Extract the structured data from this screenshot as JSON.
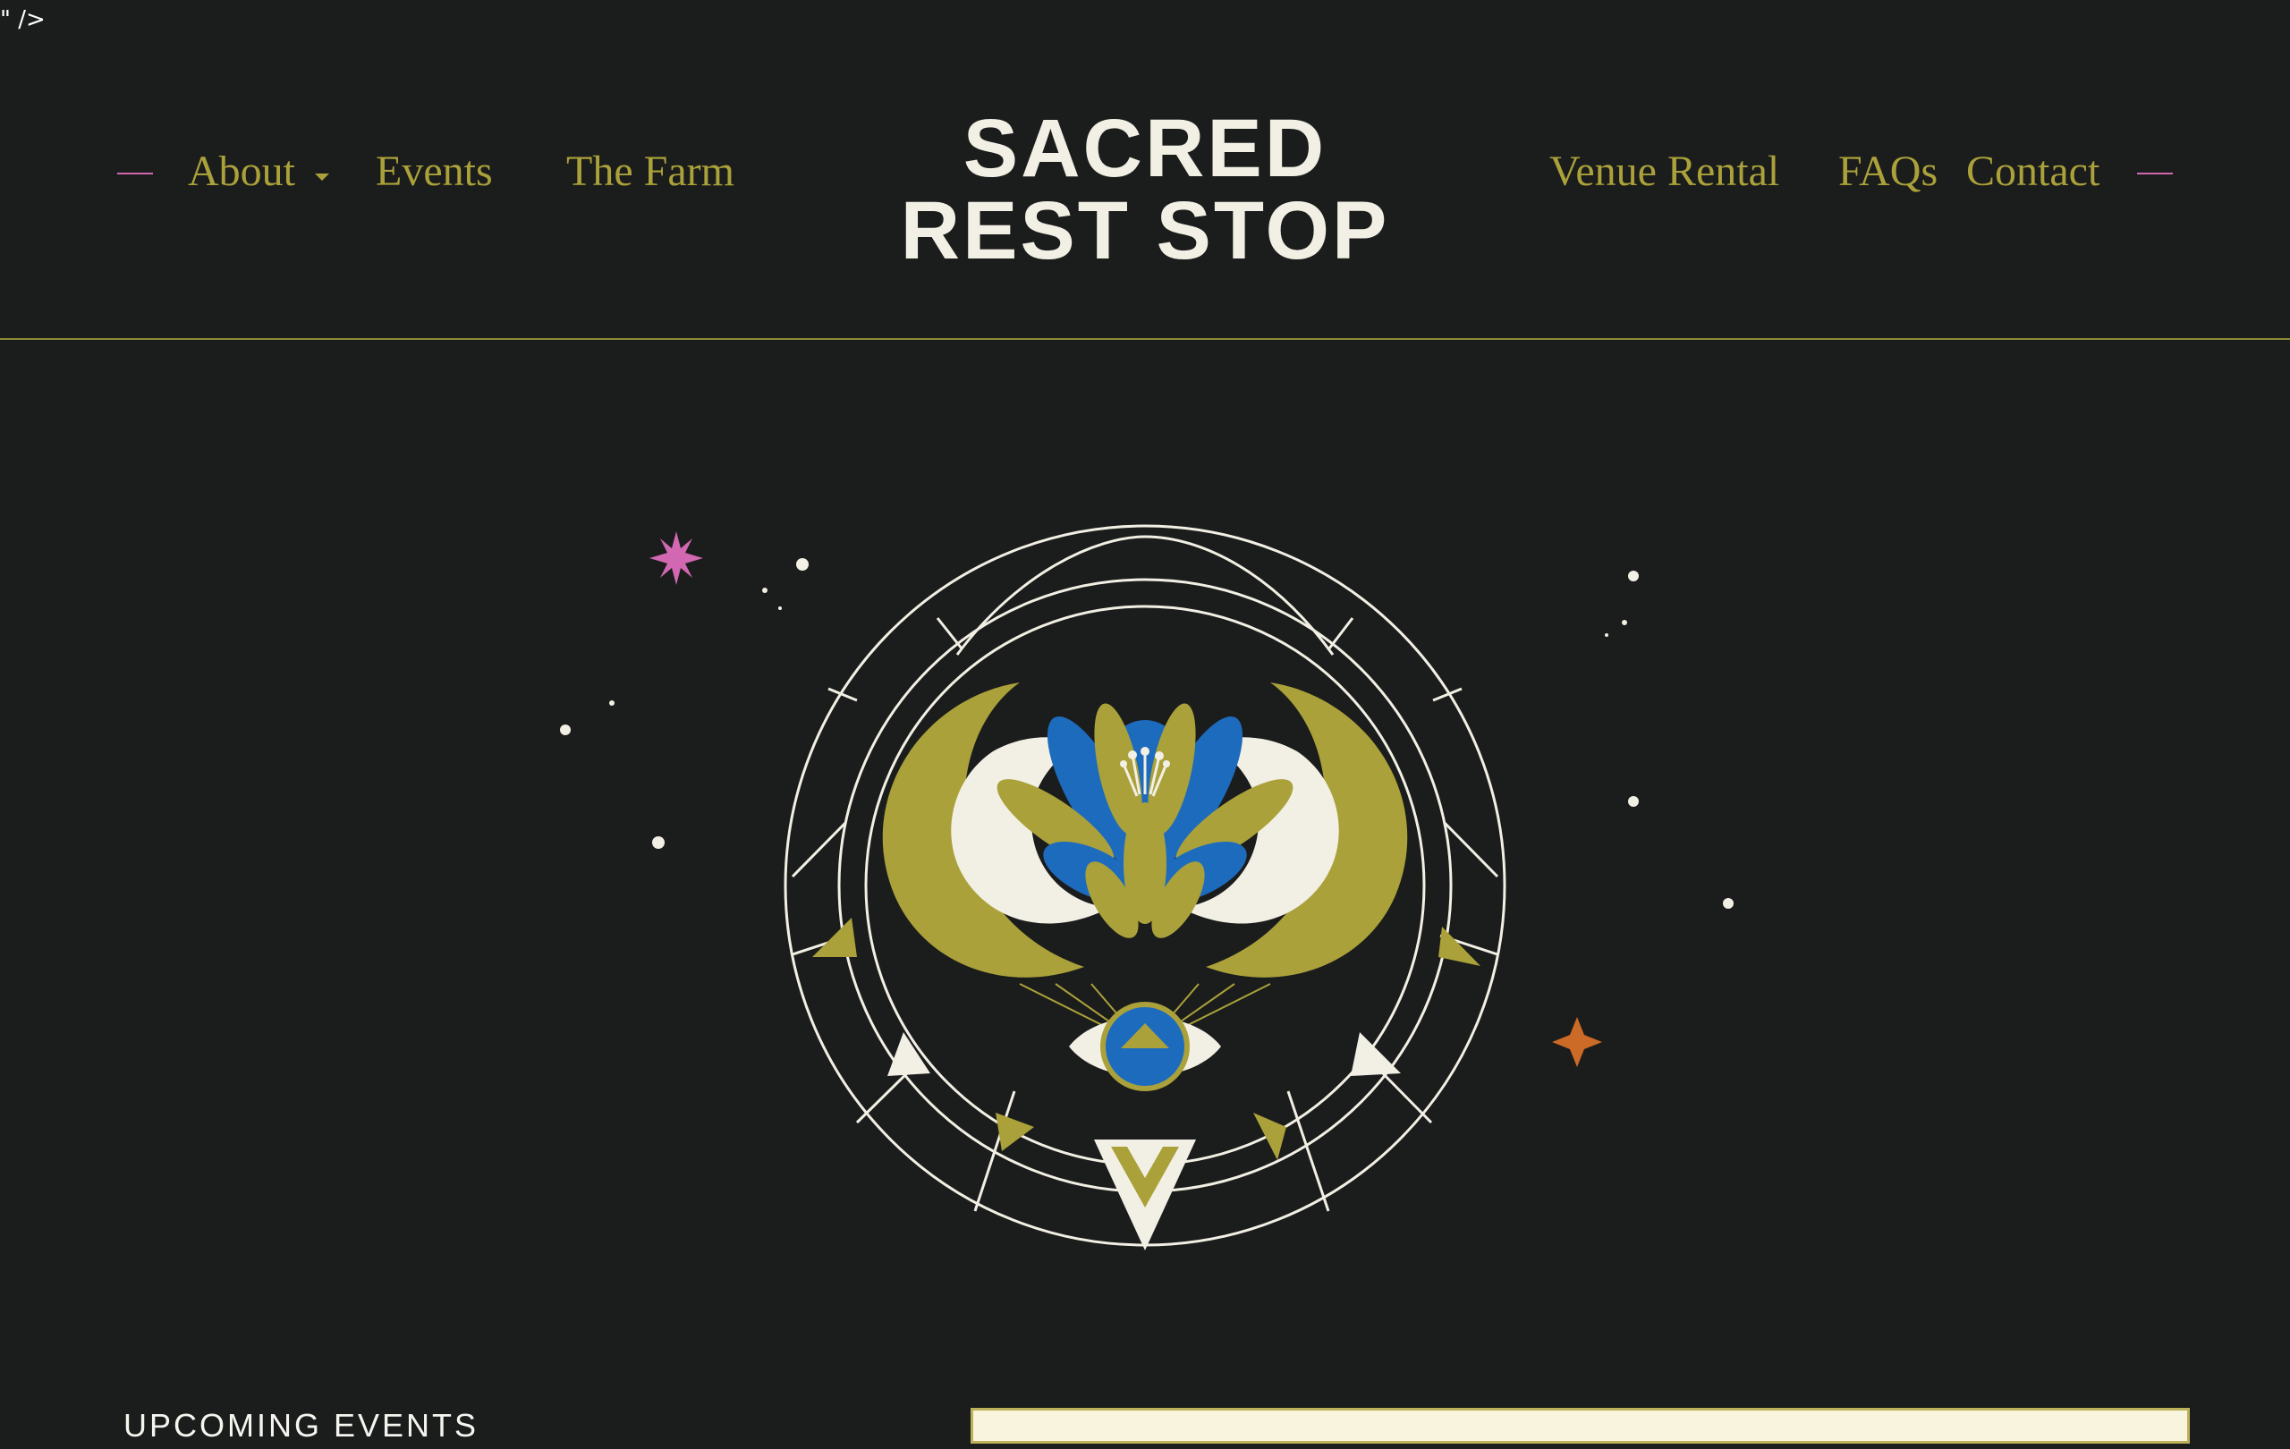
{
  "page": {
    "artifact_text": "\" />",
    "logo": {
      "line1": "SACRED",
      "line2": "REST STOP"
    },
    "nav_left": [
      {
        "label": "About",
        "has_dropdown": true
      },
      {
        "label": "Events"
      },
      {
        "label": "The Farm"
      }
    ],
    "nav_right": [
      {
        "label": "Venue Rental"
      },
      {
        "label": "FAQs"
      },
      {
        "label": "Contact"
      }
    ],
    "sections": {
      "upcoming_events_title": "UPCOMING EVENTS"
    },
    "colors": {
      "background": "#1b1c1c",
      "olive": "#aaa13a",
      "cream": "#f2f0e4",
      "pink": "#d168b1",
      "blue": "#1d6bbd",
      "orange": "#cc6a27",
      "line": "#8f8a36"
    },
    "icons": {
      "dropdown": "chevron-down-icon",
      "hero": "lotus-eye-emblem-icon",
      "pink_star": "pink-star-icon",
      "orange_star": "orange-star-icon"
    }
  }
}
